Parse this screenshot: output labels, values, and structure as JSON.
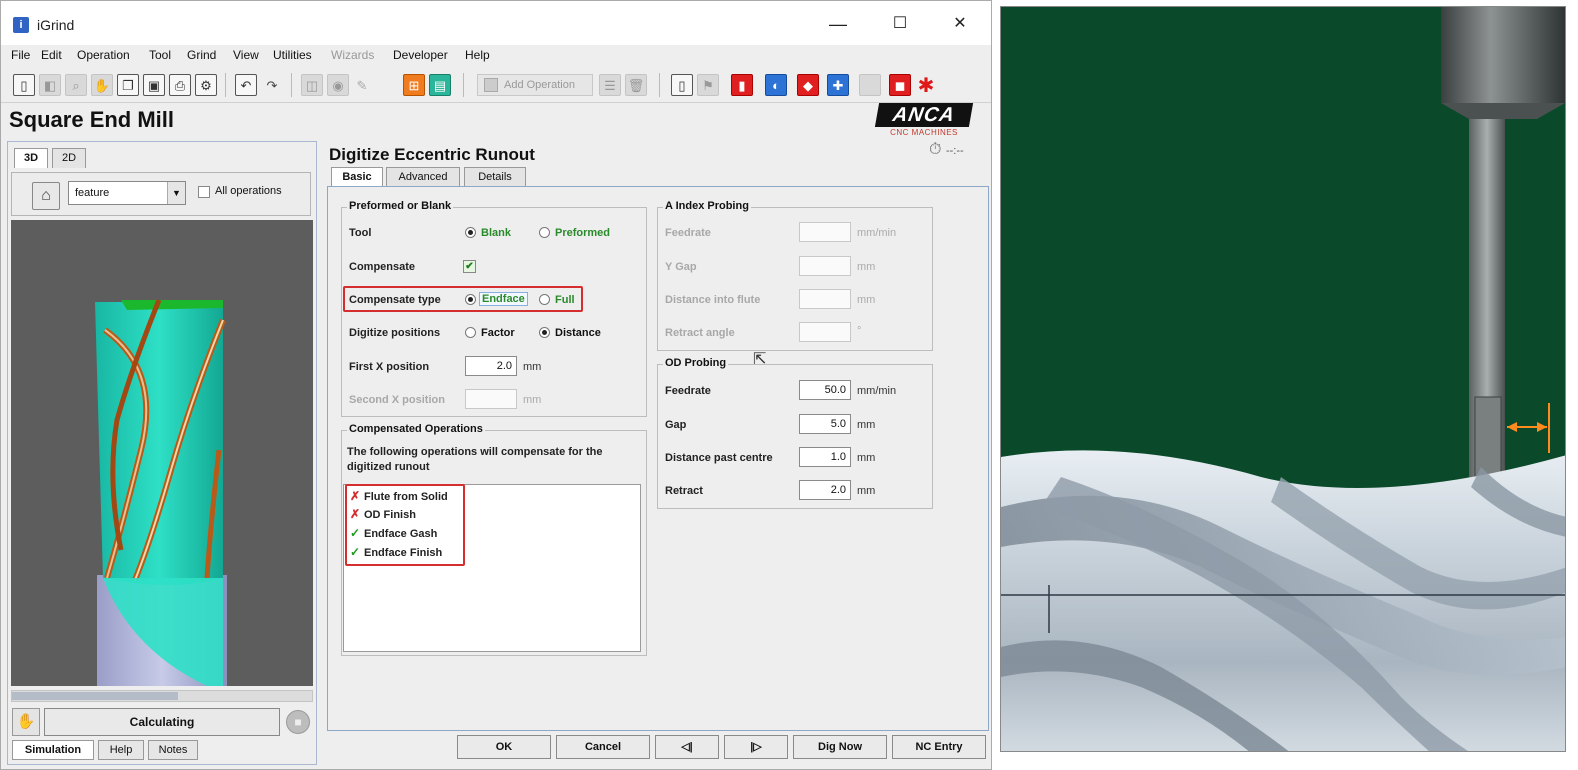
{
  "window": {
    "title": "iGrind",
    "controls": {
      "minimize": "—",
      "maximize": "☐",
      "close": "✕"
    }
  },
  "menu": [
    "File",
    "Edit",
    "Operation",
    "Tool",
    "Grind",
    "View",
    "Utilities",
    "Wizards",
    "Developer",
    "Help"
  ],
  "toolbar": {
    "add_operation": "Add Operation"
  },
  "page": {
    "title": "Square End Mill"
  },
  "logo": {
    "word": "ANCA",
    "sub": "CNC MACHINES"
  },
  "left_panel": {
    "tabs": [
      "3D",
      "2D"
    ],
    "feature_select": "feature",
    "all_operations": "All operations",
    "calc_button": "Calculating",
    "bottom_tabs": [
      "Simulation",
      "Help",
      "Notes"
    ]
  },
  "dialog": {
    "title": "Digitize Eccentric Runout",
    "tabs": [
      "Basic",
      "Advanced",
      "Details"
    ],
    "preformed": {
      "title": "Preformed or Blank",
      "tool_label": "Tool",
      "tool_options": [
        "Blank",
        "Preformed"
      ],
      "compensate_label": "Compensate",
      "compensate_type_label": "Compensate type",
      "compensate_type_options": [
        "Endface",
        "Full"
      ],
      "digitize_positions_label": "Digitize positions",
      "digitize_positions_options": [
        "Factor",
        "Distance"
      ],
      "first_x_label": "First X position",
      "first_x_value": "2.0",
      "first_x_unit": "mm",
      "second_x_label": "Second X position",
      "second_x_unit": "mm"
    },
    "compensated": {
      "title": "Compensated Operations",
      "description": "The following operations will compensate for the digitized runout",
      "operations": [
        {
          "name": "Flute from Solid",
          "ok": false
        },
        {
          "name": "OD Finish",
          "ok": false
        },
        {
          "name": "Endface Gash",
          "ok": true
        },
        {
          "name": "Endface Finish",
          "ok": true
        }
      ]
    },
    "a_index": {
      "title": "A Index Probing",
      "feedrate_label": "Feedrate",
      "feedrate_unit": "mm/min",
      "ygap_label": "Y Gap",
      "ygap_unit": "mm",
      "distance_label": "Distance into flute",
      "distance_unit": "mm",
      "retract_label": "Retract angle",
      "retract_unit": "°"
    },
    "od_probing": {
      "title": "OD Probing",
      "feedrate_label": "Feedrate",
      "feedrate_value": "50.0",
      "feedrate_unit": "mm/min",
      "gap_label": "Gap",
      "gap_value": "5.0",
      "gap_unit": "mm",
      "past_centre_label": "Distance past centre",
      "past_centre_value": "1.0",
      "past_centre_unit": "mm",
      "retract_label": "Retract",
      "retract_value": "2.0",
      "retract_unit": "mm"
    },
    "buttons": {
      "ok": "OK",
      "cancel": "Cancel",
      "prev": "◁|",
      "next": "|▷",
      "dig_now": "Dig Now",
      "nc_entry": "NC Entry"
    }
  },
  "colors": {
    "accent_red": "#d42e2e",
    "ok_green": "#1f9a1f",
    "sim_background": "#0a4a2a",
    "flute_cyan": "#21d2b8"
  }
}
